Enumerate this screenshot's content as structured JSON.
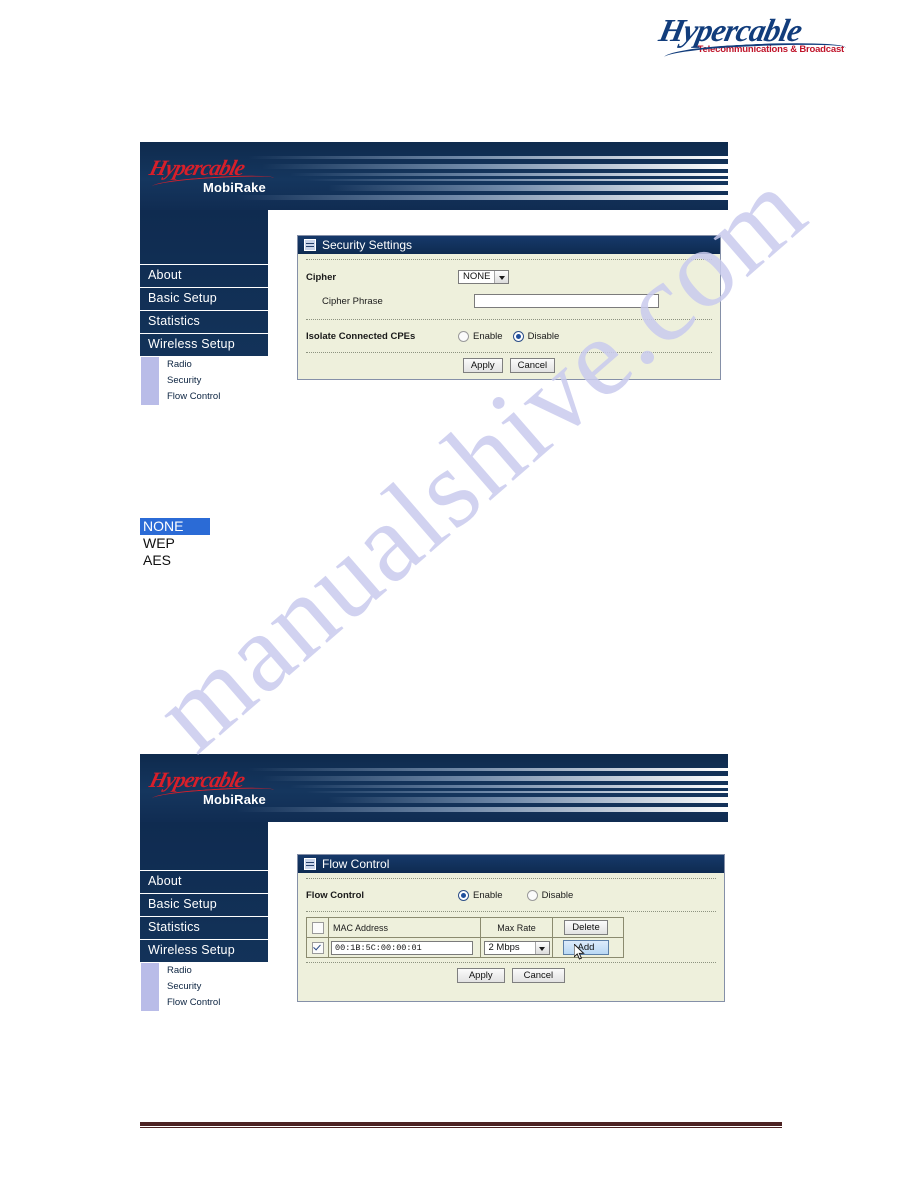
{
  "page": {
    "logo": {
      "word": "Hypercable",
      "tagline": "Telecommunications & Broadcast"
    },
    "watermark": "manualshive.com"
  },
  "device_ui": {
    "brand": {
      "word": "Hypercable",
      "model": "MobiRake"
    },
    "nav": {
      "main_items": [
        {
          "label": "About"
        },
        {
          "label": "Basic Setup"
        },
        {
          "label": "Statistics"
        },
        {
          "label": "Wireless Setup"
        }
      ],
      "sub_items": [
        {
          "label": "Radio"
        },
        {
          "label": "Security"
        },
        {
          "label": "Flow Control"
        }
      ]
    }
  },
  "security_panel": {
    "title": "Security Settings",
    "cipher": {
      "label": "Cipher",
      "value": "NONE"
    },
    "cipher_phrase": {
      "label": "Cipher Phrase",
      "value": ""
    },
    "isolate": {
      "label": "Isolate Connected CPEs",
      "enable_label": "Enable",
      "disable_label": "Disable",
      "selected": "Disable"
    },
    "apply_label": "Apply",
    "cancel_label": "Cancel"
  },
  "cipher_options": {
    "items": [
      {
        "label": "NONE",
        "selected": true
      },
      {
        "label": "WEP",
        "selected": false
      },
      {
        "label": "AES",
        "selected": false
      }
    ]
  },
  "flow_panel": {
    "title": "Flow Control",
    "flow_control": {
      "label": "Flow Control",
      "enable_label": "Enable",
      "disable_label": "Disable",
      "selected": "Enable"
    },
    "grid": {
      "headers": {
        "mac": "MAC Address",
        "rate": "Max Rate",
        "action": "Delete"
      },
      "row": {
        "mac": "00:1B:5C:00:00:01",
        "rate": "2 Mbps",
        "action": "Add"
      }
    },
    "apply_label": "Apply",
    "cancel_label": "Cancel"
  },
  "colors": {
    "nav_navy": "#123055",
    "panel_bg": "#eef0dc",
    "brand_red": "#d81f2a",
    "logo_blue": "#123d7c",
    "select_highlight": "#2b6bd6",
    "footer_maroon": "#4c2222"
  }
}
